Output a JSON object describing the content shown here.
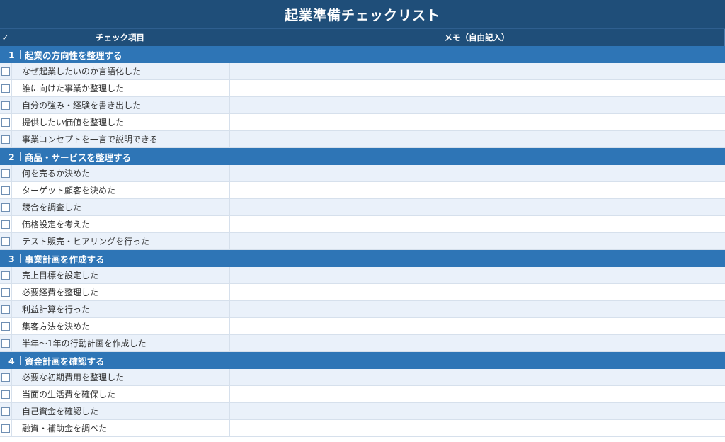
{
  "title": "起業準備チェックリスト",
  "header": {
    "check": "✓",
    "item": "チェック項目",
    "memo": "メモ（自由記入）"
  },
  "sections": [
    {
      "num": "1",
      "title": "起業の方向性を整理する",
      "items": [
        "なぜ起業したいのか言語化した",
        "誰に向けた事業か整理した",
        "自分の強み・経験を書き出した",
        "提供したい価値を整理した",
        "事業コンセプトを一言で説明できる"
      ]
    },
    {
      "num": "2",
      "title": "商品・サービスを整理する",
      "items": [
        "何を売るか決めた",
        "ターゲット顧客を決めた",
        "競合を調査した",
        "価格設定を考えた",
        "テスト販売・ヒアリングを行った"
      ]
    },
    {
      "num": "3",
      "title": "事業計画を作成する",
      "items": [
        "売上目標を設定した",
        "必要経費を整理した",
        "利益計算を行った",
        "集客方法を決めた",
        "半年〜1年の行動計画を作成した"
      ]
    },
    {
      "num": "4",
      "title": "資金計画を確認する",
      "items": [
        "必要な初期費用を整理した",
        "当面の生活費を確保した",
        "自己資金を確認した",
        "融資・補助金を調べた"
      ]
    }
  ],
  "colors": {
    "title_bg": "#1f4e79",
    "section_bg": "#2e75b6",
    "row_alt": "#eaf1fa"
  }
}
